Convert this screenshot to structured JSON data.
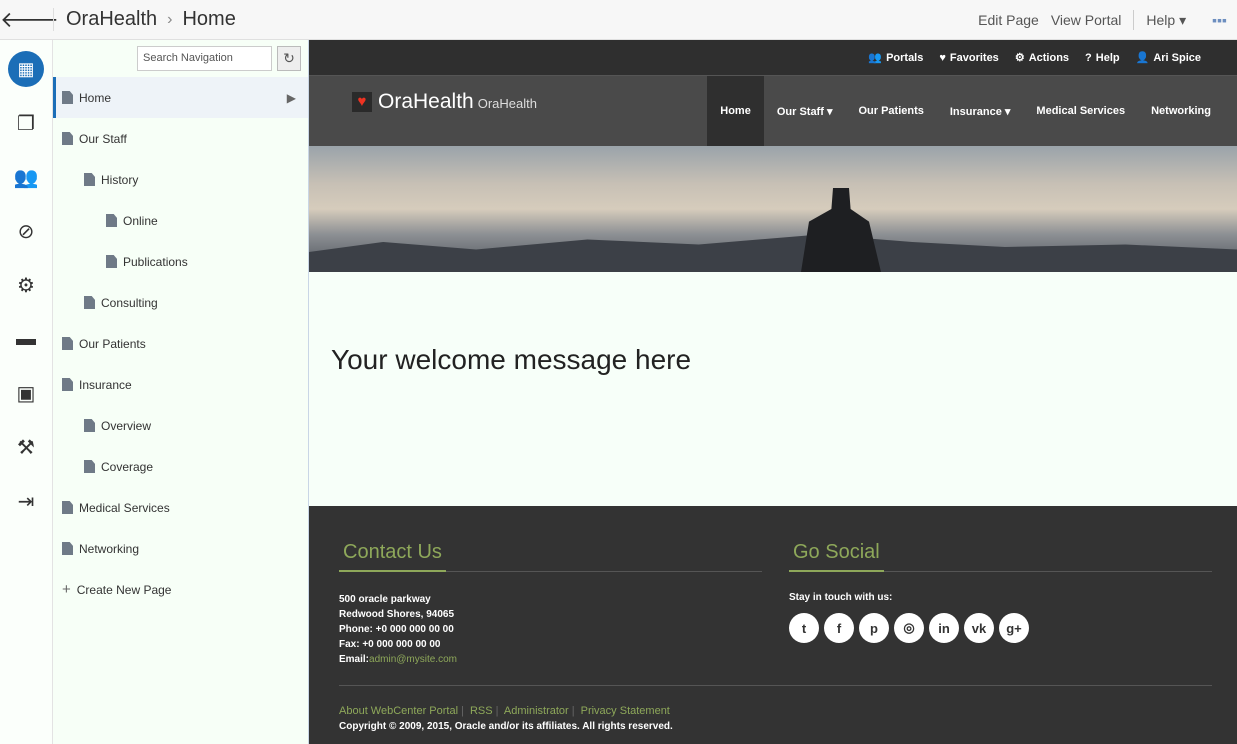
{
  "topbar": {
    "title": "OraHealth",
    "page": "Home",
    "links": [
      "Edit Page",
      "View Portal"
    ],
    "help": "Help"
  },
  "nav": {
    "search_placeholder": "Search Navigation",
    "items": [
      {
        "label": "Home",
        "level": 0
      },
      {
        "label": "Our Staff",
        "level": 0
      },
      {
        "label": "History",
        "level": 1
      },
      {
        "label": "Online",
        "level": 2
      },
      {
        "label": "Publications",
        "level": 2
      },
      {
        "label": "Consulting",
        "level": 1
      },
      {
        "label": "Our Patients",
        "level": 0
      },
      {
        "label": "Insurance",
        "level": 0
      },
      {
        "label": "Overview",
        "level": 1
      },
      {
        "label": "Coverage",
        "level": 1
      },
      {
        "label": "Medical Services",
        "level": 0
      },
      {
        "label": "Networking",
        "level": 0
      }
    ],
    "create": "Create New Page"
  },
  "strip": {
    "portals": "Portals",
    "favorites": "Favorites",
    "actions": "Actions",
    "help": "Help",
    "user": "Ari Spice"
  },
  "site": {
    "brand": "OraHealth",
    "sub": "OraHealth",
    "menu": [
      "Home",
      "Our Staff ▾",
      "Our Patients",
      "Insurance ▾",
      "Medical Services",
      "Networking"
    ]
  },
  "welcome": "Your welcome message here",
  "footer": {
    "contact_title": "Contact Us",
    "address1": "500 oracle parkway",
    "address2": "Redwood Shores, 94065",
    "phone": "Phone: +0 000 000 00 00",
    "fax": "Fax: +0 000 000 00 00",
    "email_label": "Email:",
    "email": "admin@mysite.com",
    "social_title": "Go Social",
    "stay": "Stay in touch with us:",
    "links": [
      "About WebCenter Portal",
      "RSS",
      "Administrator",
      "Privacy Statement"
    ],
    "copyright": "Copyright © 2009, 2015, Oracle and/or its affiliates. All rights reserved."
  }
}
